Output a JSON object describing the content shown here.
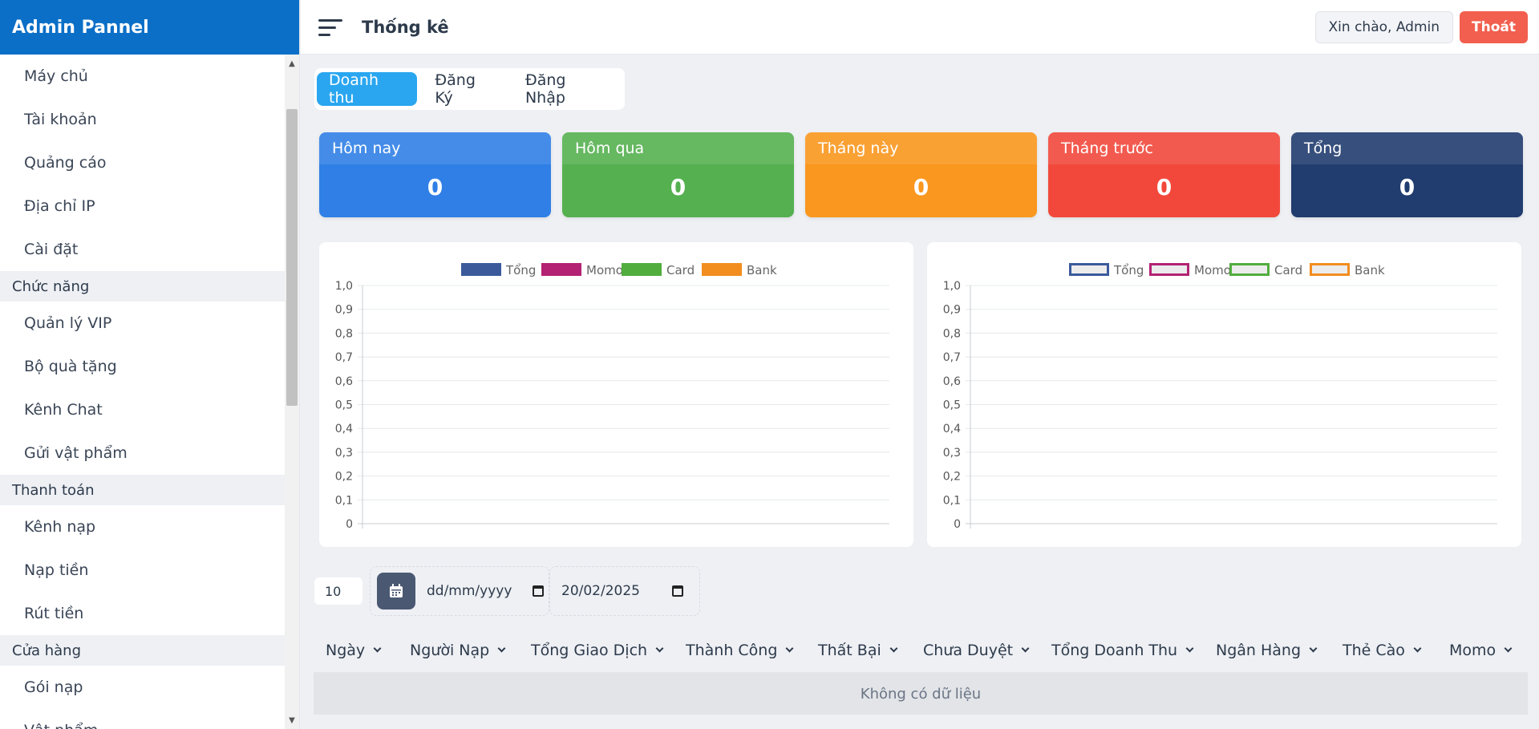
{
  "brand": "Admin Pannel",
  "header": {
    "title": "Thống kê",
    "greeting": "Xin chào, Admin",
    "logout": "Thoát"
  },
  "sidebar": {
    "sections": [
      {
        "type": "item",
        "label": "Máy chủ"
      },
      {
        "type": "item",
        "label": "Tài khoản"
      },
      {
        "type": "item",
        "label": "Quảng cáo"
      },
      {
        "type": "item",
        "label": "Địa chỉ IP"
      },
      {
        "type": "item",
        "label": "Cài đặt"
      },
      {
        "type": "group",
        "label": "Chức năng"
      },
      {
        "type": "item",
        "label": "Quản lý VIP"
      },
      {
        "type": "item",
        "label": "Bộ quà tặng"
      },
      {
        "type": "item",
        "label": "Kênh Chat"
      },
      {
        "type": "item",
        "label": "Gửi vật phẩm"
      },
      {
        "type": "group",
        "label": "Thanh toán"
      },
      {
        "type": "item",
        "label": "Kênh nạp"
      },
      {
        "type": "item",
        "label": "Nạp tiền"
      },
      {
        "type": "item",
        "label": "Rút tiền"
      },
      {
        "type": "group",
        "label": "Cửa hàng"
      },
      {
        "type": "item",
        "label": "Gói nạp"
      },
      {
        "type": "item",
        "label": "Vật phẩm"
      }
    ]
  },
  "tabs": [
    {
      "label": "Doanh thu",
      "active": true
    },
    {
      "label": "Đăng Ký",
      "active": false
    },
    {
      "label": "Đăng Nhập",
      "active": false
    }
  ],
  "stats": [
    {
      "label": "Hôm nay",
      "value": "0",
      "color": "#2f7fe6"
    },
    {
      "label": "Hôm qua",
      "value": "0",
      "color": "#55b050"
    },
    {
      "label": "Tháng này",
      "value": "0",
      "color": "#fa971e"
    },
    {
      "label": "Tháng trước",
      "value": "0",
      "color": "#f2483b"
    },
    {
      "label": "Tổng",
      "value": "0",
      "color": "#213c6e"
    }
  ],
  "chart_data": [
    {
      "type": "bar",
      "series": [
        {
          "name": "Tổng",
          "color": "#3a5a9c",
          "values": []
        },
        {
          "name": "Momo",
          "color": "#b32273",
          "values": []
        },
        {
          "name": "Card",
          "color": "#51ad3e",
          "values": []
        },
        {
          "name": "Bank",
          "color": "#f28d1f",
          "values": []
        }
      ],
      "ylim": [
        0,
        1
      ],
      "yticks": [
        "0",
        "0,1",
        "0,2",
        "0,3",
        "0,4",
        "0,5",
        "0,6",
        "0,7",
        "0,8",
        "0,9",
        "1,0"
      ],
      "legend": "top",
      "grid": true
    },
    {
      "type": "line",
      "series": [
        {
          "name": "Tổng",
          "color": "#3a5a9c",
          "values": []
        },
        {
          "name": "Momo",
          "color": "#b32273",
          "values": []
        },
        {
          "name": "Card",
          "color": "#51ad3e",
          "values": []
        },
        {
          "name": "Bank",
          "color": "#f28d1f",
          "values": []
        }
      ],
      "ylim": [
        0,
        1
      ],
      "yticks": [
        "0",
        "0,1",
        "0,2",
        "0,3",
        "0,4",
        "0,5",
        "0,6",
        "0,7",
        "0,8",
        "0,9",
        "1,0"
      ],
      "legend": "top",
      "grid": true
    }
  ],
  "filters": {
    "page_size": "10",
    "date_from_placeholder": "dd/mm/yyyy",
    "date_to": "20/02/2025"
  },
  "table": {
    "columns": [
      "Ngày",
      "Người Nạp",
      "Tổng Giao Dịch",
      "Thành Công",
      "Thất Bại",
      "Chưa Duyệt",
      "Tổng Doanh Thu",
      "Ngân Hàng",
      "Thẻ Cào",
      "Momo"
    ],
    "empty": "Không có dữ liệu"
  },
  "icons": {
    "menu": "hamburger-icon",
    "calendar": "calendar-icon"
  }
}
